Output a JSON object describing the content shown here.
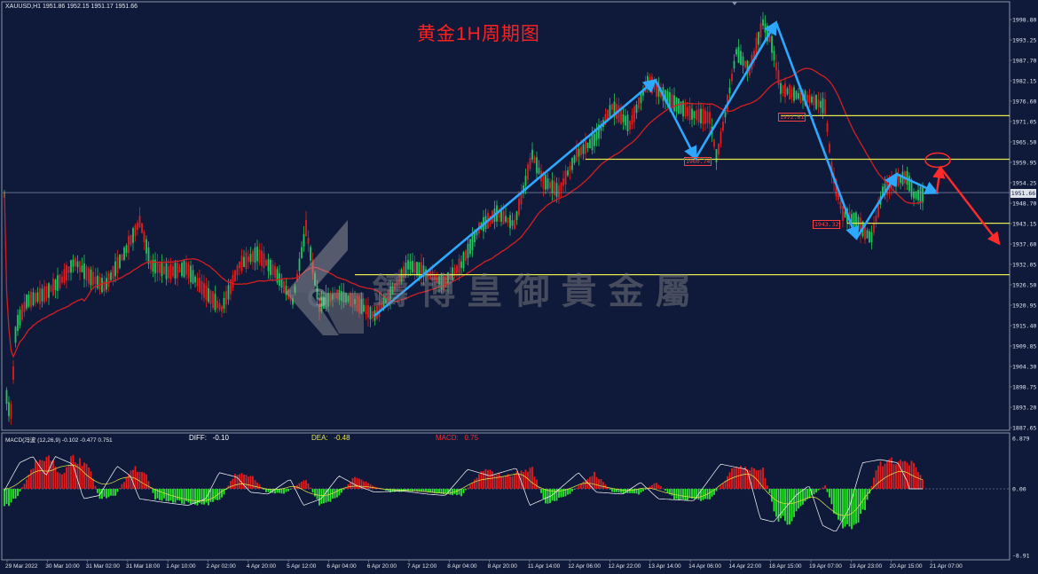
{
  "header": {
    "symbol_info": "XAUUSD,H1  1951.86 1952.15 1951.17 1951.66",
    "title": "黄金1H周期图"
  },
  "watermark": {
    "text": "鑄 博 皇 御 貴 金 屬"
  },
  "colors": {
    "background": "#0f1a3a",
    "bull": "#22c55e",
    "bear": "#e11d1d",
    "ma_line": "#d41f1f",
    "level_line": "#e8e84a",
    "wave_arrow": "#2ea8ff",
    "forecast_arrow": "#ff2a2a",
    "macd_pos": "#e11d1d",
    "macd_neg": "#2ee62e"
  },
  "price_axis_labels": [
    "1998.80",
    "1993.25",
    "1987.70",
    "1982.15",
    "1976.60",
    "1971.05",
    "1965.50",
    "1959.95",
    "1954.25",
    "1948.70",
    "1943.15",
    "1937.60",
    "1932.05",
    "1926.50",
    "1920.95",
    "1915.40",
    "1909.85",
    "1904.30",
    "1898.75",
    "1893.20",
    "1887.65"
  ],
  "current_price": "1951.66",
  "level_labels": [
    "1972.61",
    "1960.74",
    "1943.32"
  ],
  "macd": {
    "label": "MACD(冯波 (12,26,9) -0.102 -0.477 0.751",
    "diff_label": "DIFF:",
    "diff_value": "-0.10",
    "dea_label": "DEA:",
    "dea_value": "-0.48",
    "macd_label": "MACD:",
    "macd_value": "0.75",
    "axis_labels": [
      "6.879",
      "0.00",
      "-8.91"
    ]
  },
  "time_labels": [
    "29 Mar 2022",
    "30 Mar 10:00",
    "31 Mar 02:00",
    "31 Mar 18:00",
    "1 Apr 10:00",
    "2 Apr 02:00",
    "4 Apr 20:00",
    "5 Apr 12:00",
    "6 Apr 04:00",
    "6 Apr 20:00",
    "7 Apr 12:00",
    "8 Apr 04:00",
    "8 Apr 20:00",
    "11 Apr 14:00",
    "12 Apr 06:00",
    "12 Apr 22:00",
    "13 Apr 14:00",
    "14 Apr 06:00",
    "14 Apr 22:00",
    "18 Apr 15:00",
    "19 Apr 07:00",
    "19 Apr 23:00",
    "20 Apr 15:00",
    "21 Apr 07:00"
  ],
  "chart_data": {
    "type": "candlestick",
    "symbol": "XAUUSD",
    "timeframe": "H1",
    "ylim": [
      1887.65,
      1998.8
    ],
    "horizontal_levels": [
      1972.61,
      1960.74,
      1943.32,
      1929.3
    ],
    "wave_points": [
      {
        "x": "6 Apr 20:00",
        "y": 1918.0
      },
      {
        "x": "13 Apr 14:00",
        "y": 1982.3
      },
      {
        "x": "14 Apr 06:00",
        "y": 1961.0
      },
      {
        "x": "18 Apr 15:00",
        "y": 1998.0
      },
      {
        "x": "19 Apr 23:00",
        "y": 1939.2
      },
      {
        "x": "20 Apr 15:00",
        "y": 1956.7
      },
      {
        "x": "21 Apr 07:00",
        "y": 1951.6
      }
    ],
    "forecast_points": [
      {
        "x": "21 Apr 07:00",
        "y": 1951.6
      },
      {
        "x": "21 Apr 12:00",
        "y": 1958.5
      },
      {
        "x": "21 Apr 23:00",
        "y": 1937.8
      }
    ]
  }
}
